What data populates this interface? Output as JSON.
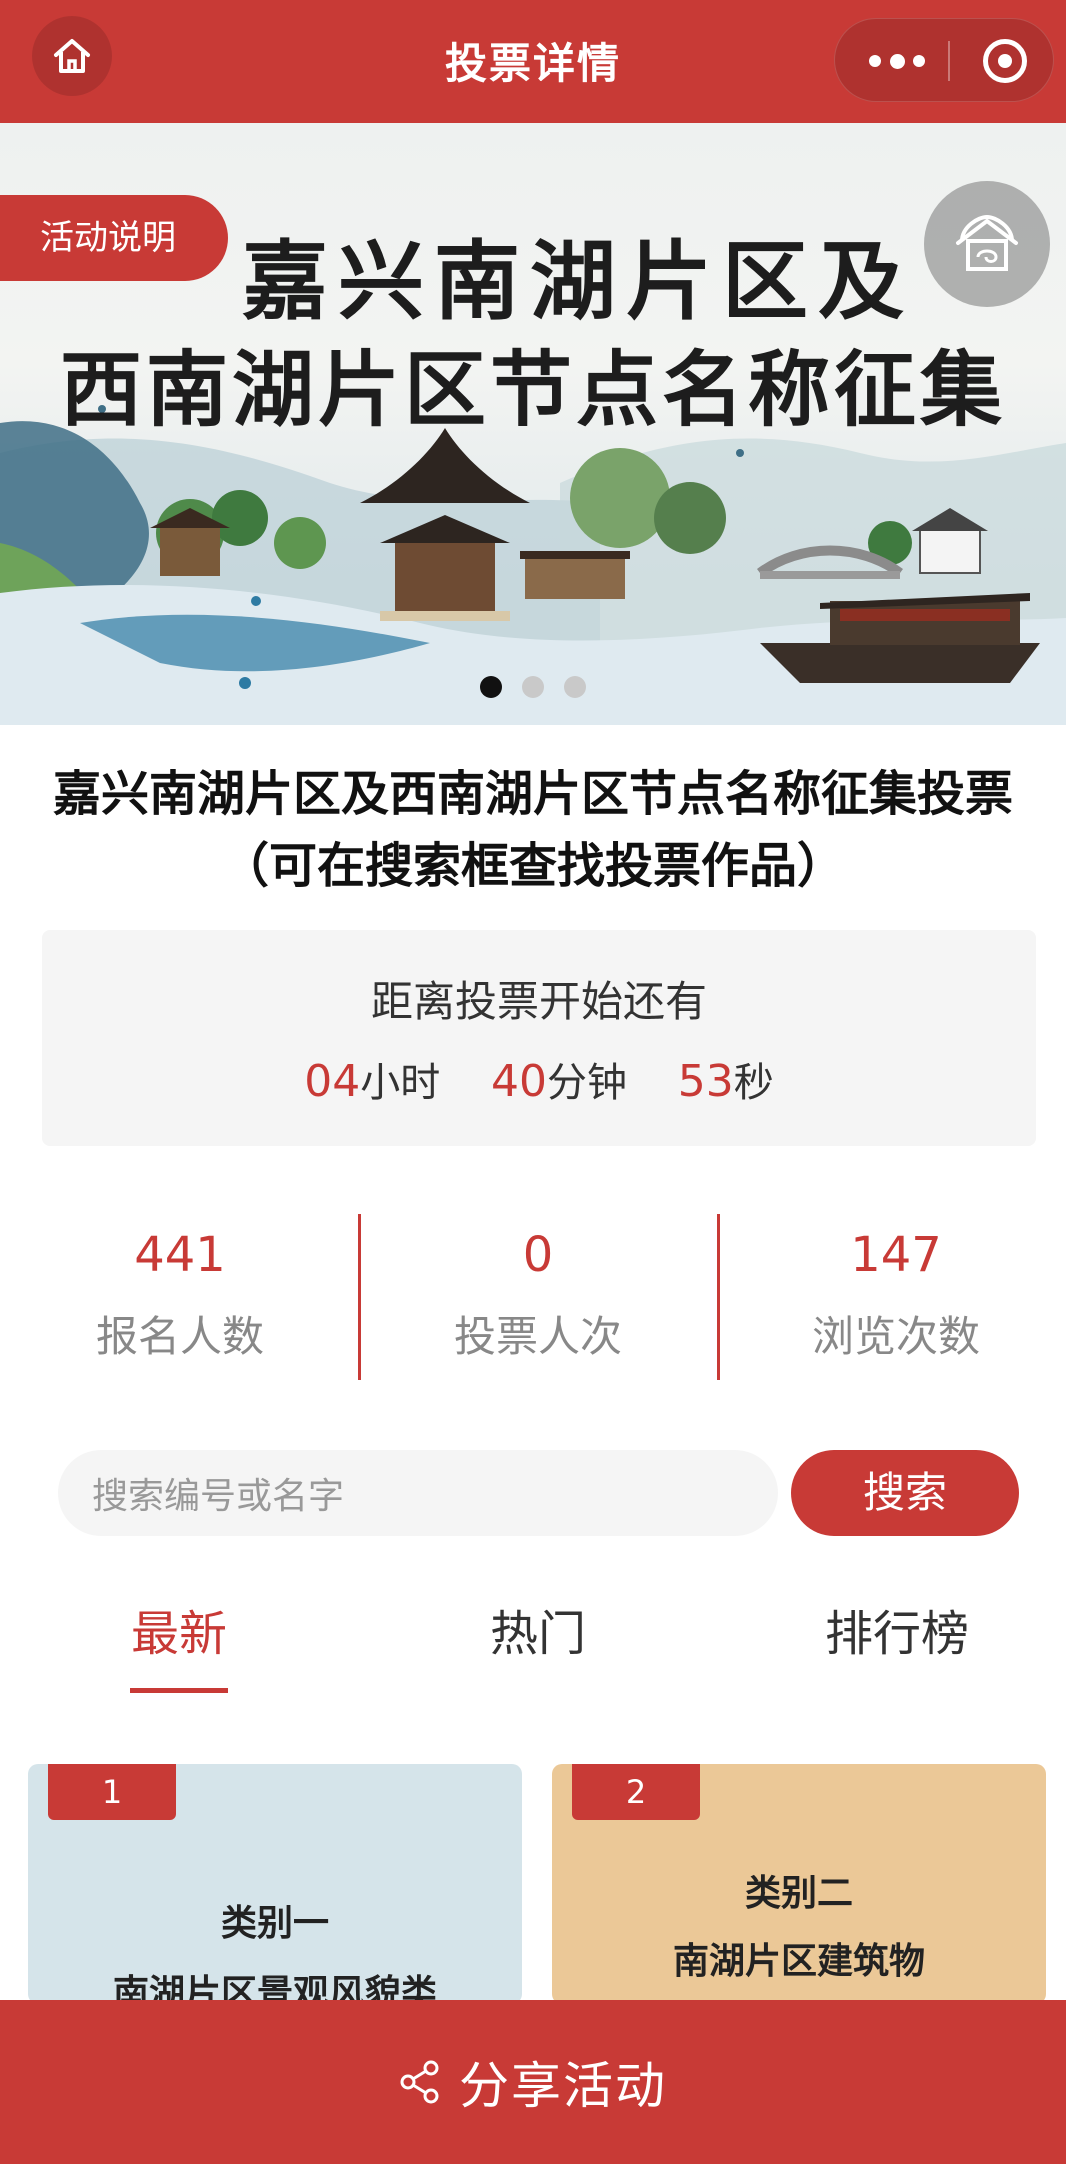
{
  "header": {
    "title": "投票详情",
    "home_icon": "home-icon",
    "more_icon": "more-dots-icon",
    "close_icon": "target-close-icon"
  },
  "banner": {
    "tag_label": "活动说明",
    "title_line1": "嘉兴南湖片区及",
    "title_line2": "西南湖片区节点名称征集",
    "float_icon": "home-icon",
    "slides_total": 3,
    "slide_active": 1
  },
  "event": {
    "title_line1": "嘉兴南湖片区及西南湖片区节点名称征集投票",
    "title_line2": "（可在搜索框查找投票作品）"
  },
  "countdown": {
    "label": "距离投票开始还有",
    "hours": "04",
    "hours_unit": "小时",
    "minutes": "40",
    "minutes_unit": "分钟",
    "seconds": "53",
    "seconds_unit": "秒"
  },
  "stats": [
    {
      "value": "441",
      "label": "报名人数"
    },
    {
      "value": "0",
      "label": "投票人次"
    },
    {
      "value": "147",
      "label": "浏览次数"
    }
  ],
  "search": {
    "placeholder": "搜索编号或名字",
    "button_label": "搜索"
  },
  "tabs": [
    {
      "label": "最新",
      "active": true
    },
    {
      "label": "热门",
      "active": false
    },
    {
      "label": "排行榜",
      "active": false
    }
  ],
  "cards": [
    {
      "number": "1",
      "line1": "类别一",
      "line2": "南湖片区景观风貌类"
    },
    {
      "number": "2",
      "line1": "类别二",
      "line2": "南湖片区建筑物"
    }
  ],
  "share": {
    "label": "分享活动",
    "icon": "share-icon"
  },
  "colors": {
    "primary": "#c83a36",
    "muted_text": "#888888",
    "panel_bg": "#f5f5f5"
  }
}
